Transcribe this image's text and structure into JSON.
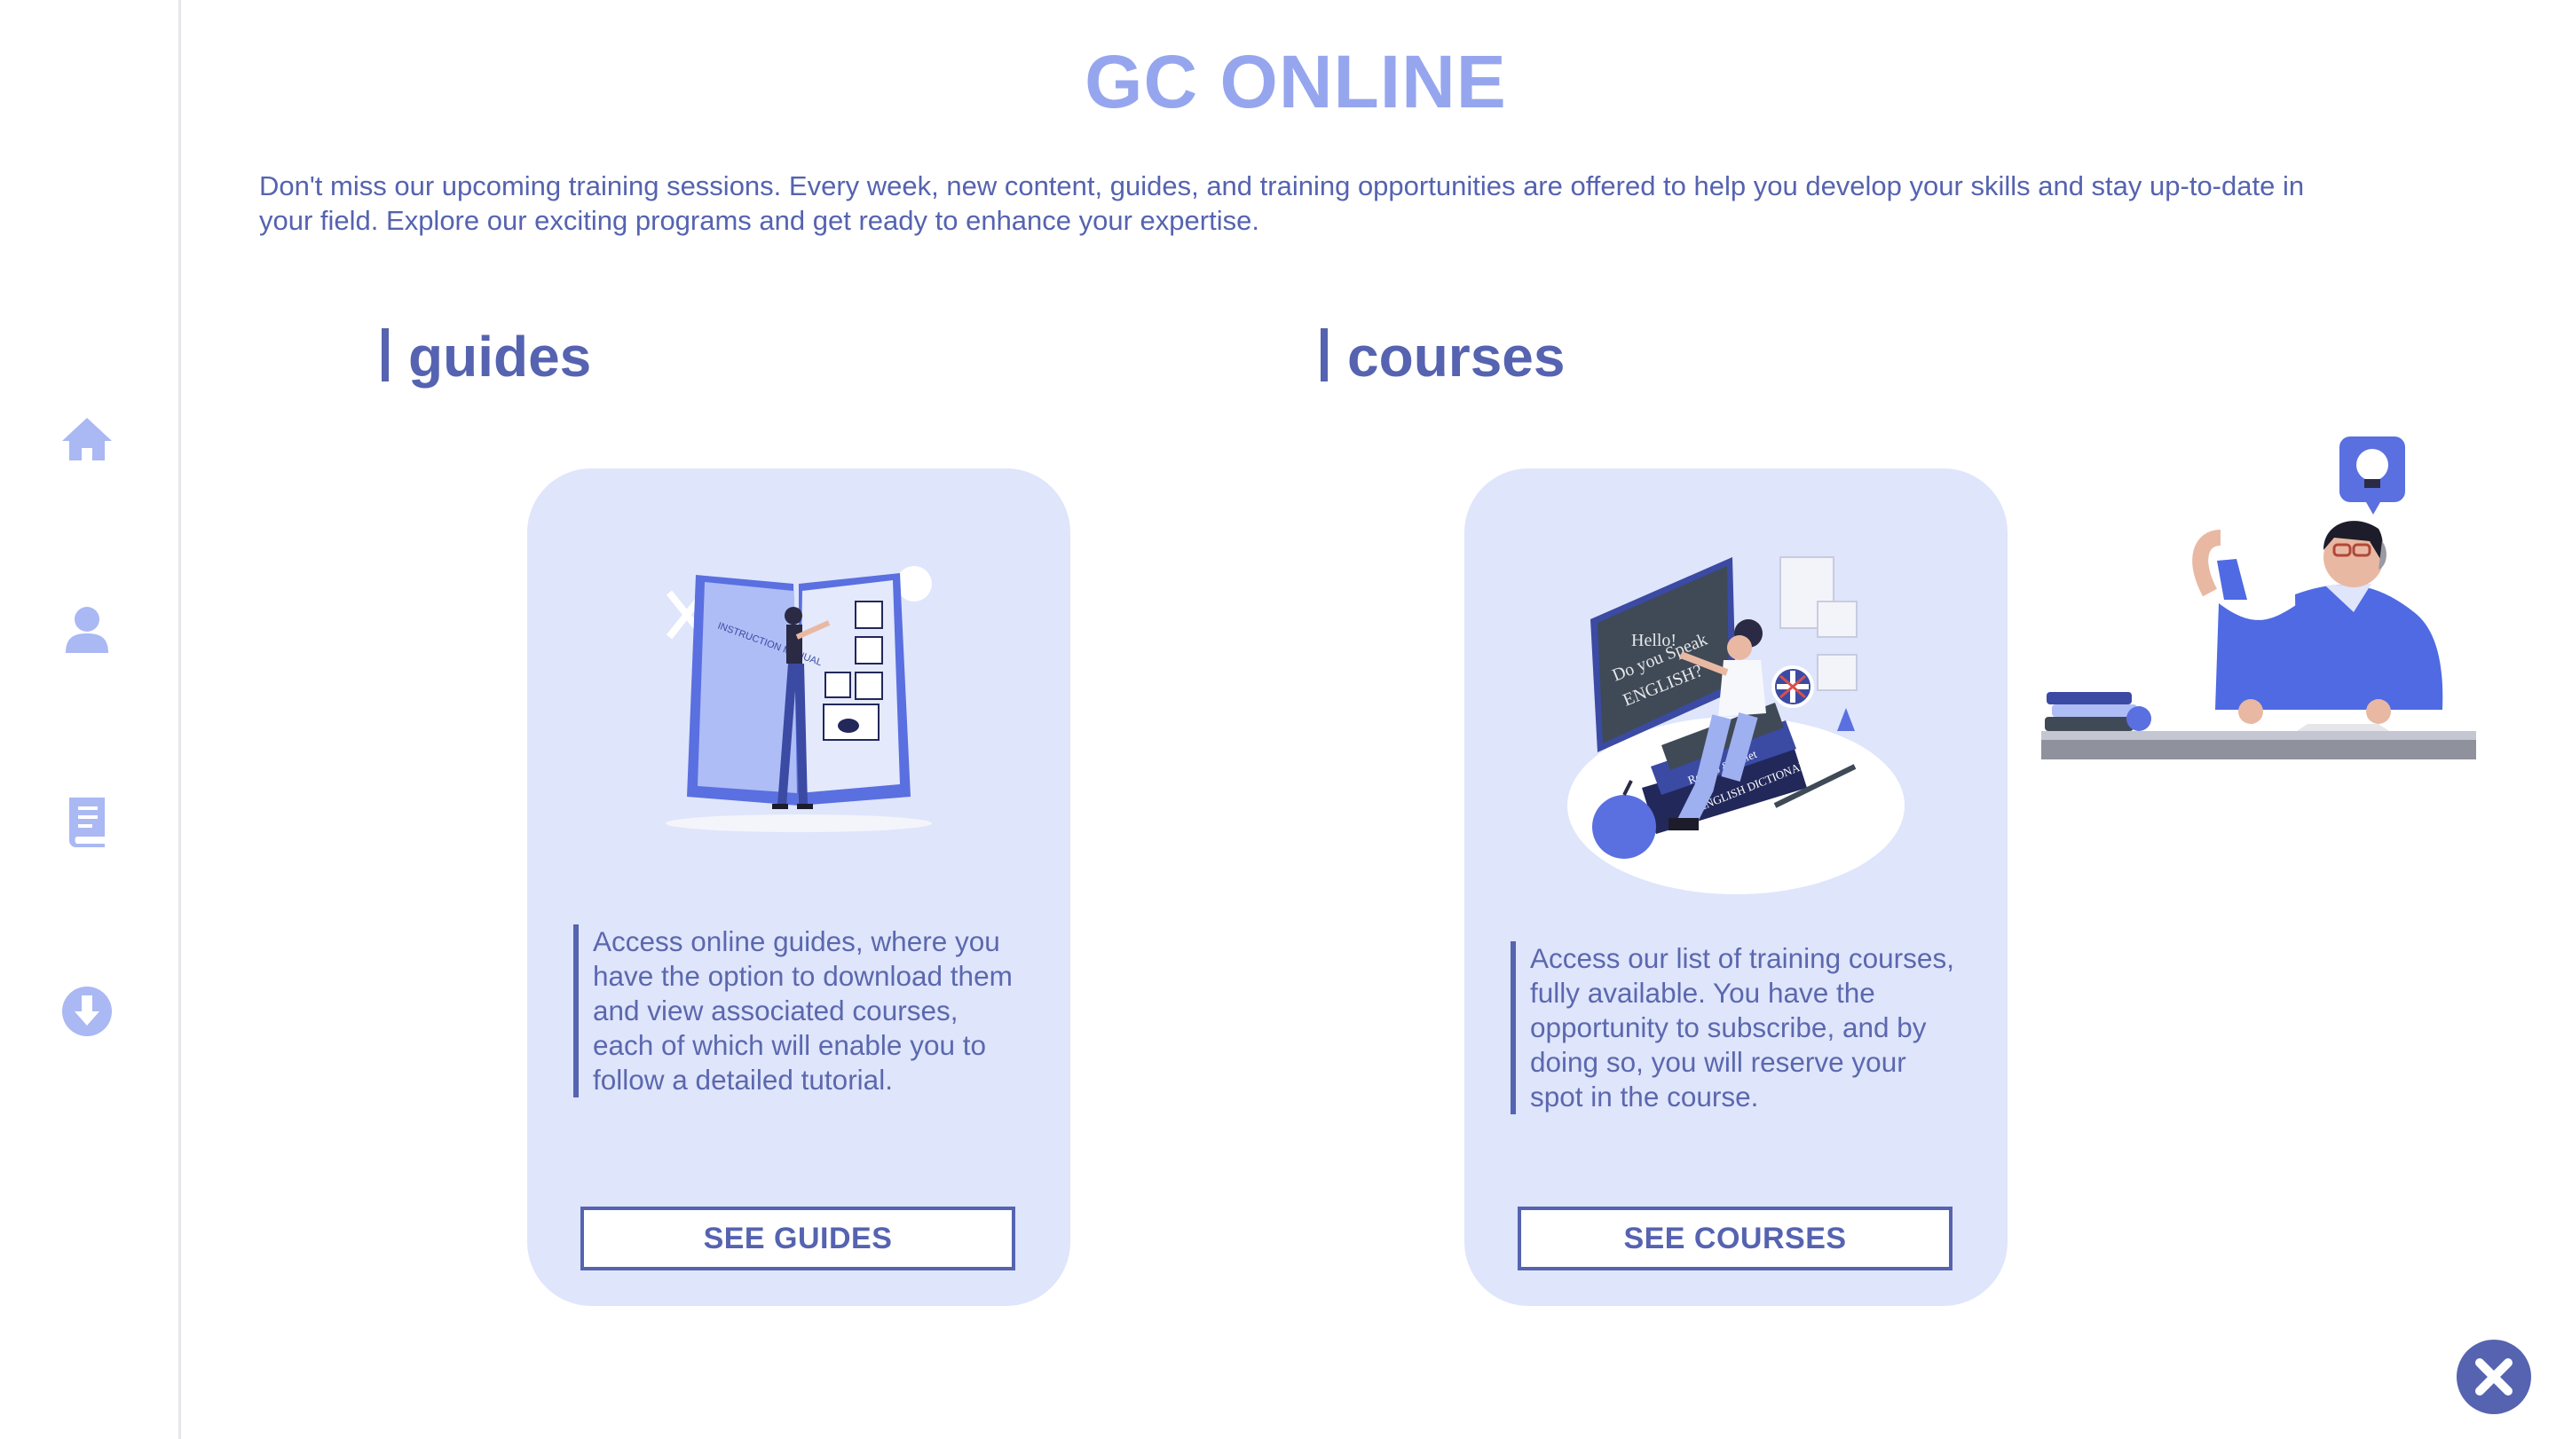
{
  "header": {
    "title": "GC ONLINE",
    "intro": "Don't miss our upcoming training sessions. Every week, new content, guides, and training opportunities are offered to help you develop your skills and stay up-to-date in your field. Explore our exciting programs and get ready to enhance your expertise."
  },
  "sidebar": {
    "items": [
      {
        "icon": "home-icon"
      },
      {
        "icon": "user-icon"
      },
      {
        "icon": "book-icon"
      },
      {
        "icon": "download-icon"
      }
    ]
  },
  "guides": {
    "heading": "guides",
    "description": "Access online guides, where you have the option to download them and view associated courses, each of which will enable you to follow a detailed tutorial.",
    "button_label": "SEE GUIDES",
    "illustration_text": "INSTRUCTION MANUAL"
  },
  "courses": {
    "heading": "courses",
    "description": "Access our list of training courses, fully available. You have the opportunity to subscribe, and by doing so, you will reserve your spot in the course.",
    "button_label": "SEE COURSES",
    "chalkboard_text": [
      "Hello!",
      "Do you Speak",
      "ENGLISH?"
    ],
    "book_spines": [
      "Romeo & Juliet",
      "ENGLISH DICTIONARY"
    ]
  },
  "colors": {
    "accent": "#5563b0",
    "title": "#96a6ee",
    "card_bg": "#dfe5fb",
    "icon": "#aab8f3"
  }
}
